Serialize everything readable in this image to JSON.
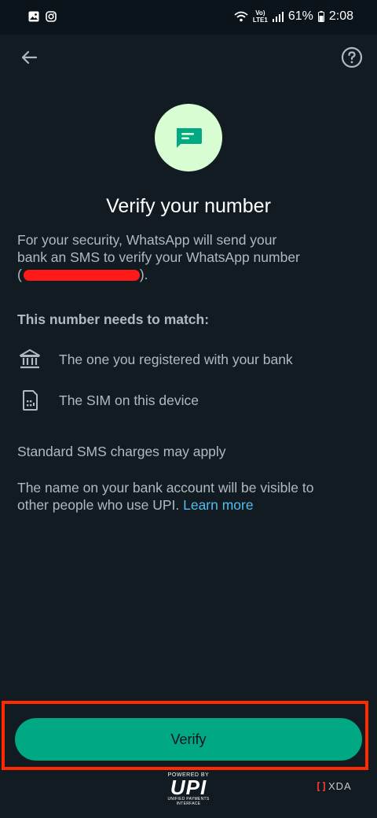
{
  "status": {
    "battery": "61%",
    "time": "2:08",
    "network_line1": "Vo)",
    "network_line2": "LTE1"
  },
  "appbar": {
    "back_icon": "arrow-left-icon",
    "help_icon": "question-mark-icon"
  },
  "hero_icon": "message-icon",
  "title": "Verify your number",
  "intro": {
    "line1": "For your security, WhatsApp will send your",
    "line2": "bank an SMS to verify your WhatsApp number",
    "open_paren": "(",
    "close_paren": ")."
  },
  "match_heading": "This number needs to match:",
  "match_items": [
    {
      "icon": "bank-icon",
      "label": "The one you registered with your bank"
    },
    {
      "icon": "sim-card-icon",
      "label": "The SIM on this device"
    }
  ],
  "sms_note": "Standard SMS charges may apply",
  "visibility_note": {
    "line1": "The name on your bank account will be visible to",
    "line2": "other people who use UPI. ",
    "link": "Learn more"
  },
  "verify_button": "Verify",
  "footer": {
    "powered_by": "POWERED BY",
    "upi": "UPI",
    "upi_sub": "UNIFIED PAYMENTS INTERFACE",
    "watermark": "XDA"
  },
  "colors": {
    "background": "#121b22",
    "accent": "#00a884",
    "link": "#53bdeb",
    "highlight_border": "#ff2a00",
    "redaction": "#ff1a1a"
  }
}
